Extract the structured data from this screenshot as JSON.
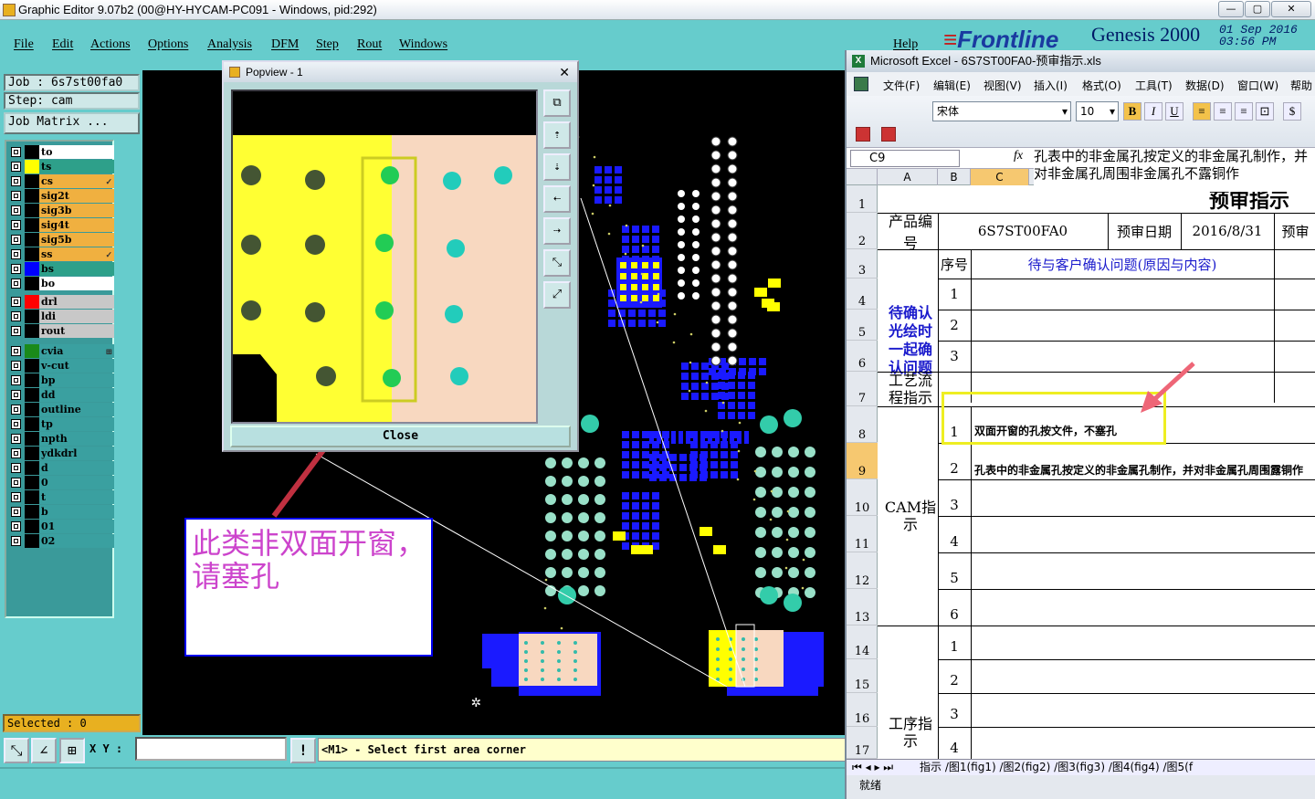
{
  "genesis": {
    "title": "Graphic Editor 9.07b2 (00@HY-HYCAM-PC091 - Windows, pid:292)",
    "menu": [
      "File",
      "Edit",
      "Actions",
      "Options",
      "Analysis",
      "DFM",
      "Step",
      "Rout",
      "Windows"
    ],
    "help": "Help",
    "brand_name": "Frontline",
    "brand_product": "Genesis 2000",
    "date": "01 Sep 2016",
    "time": "03:56 PM",
    "job": "Job : 6s7st00fa0",
    "step": "Step: cam",
    "job_matrix": "Job Matrix ...",
    "layers": [
      {
        "name": "to",
        "color": "#000000",
        "bg": "#ffffff"
      },
      {
        "name": "ts",
        "color": "#ffff00",
        "bg": "#2ea08a"
      },
      {
        "name": "cs",
        "color": "#000000",
        "bg": "#f0b040",
        "mark": "✓"
      },
      {
        "name": "sig2t",
        "color": "#000000",
        "bg": "#f0b040"
      },
      {
        "name": "sig3b",
        "color": "#000000",
        "bg": "#f0b040"
      },
      {
        "name": "sig4t",
        "color": "#000000",
        "bg": "#f0b040"
      },
      {
        "name": "sig5b",
        "color": "#000000",
        "bg": "#f0b040"
      },
      {
        "name": "ss",
        "color": "#000000",
        "bg": "#f0b040",
        "mark": "✓"
      },
      {
        "name": "bs",
        "color": "#0000ff",
        "bg": "#2ea08a"
      },
      {
        "name": "bo",
        "color": "#000000",
        "bg": "#ffffff"
      },
      {
        "name": "drl",
        "color": "#ff0000",
        "bg": "#c8c8c8"
      },
      {
        "name": "ldi",
        "color": "#000000",
        "bg": "#c8c8c8"
      },
      {
        "name": "rout",
        "color": "#000000",
        "bg": "#c8c8c8"
      },
      {
        "name": "cvia",
        "color": "#1a8a1a",
        "bg": "#3aa0a0",
        "mark": "⊞"
      },
      {
        "name": "v-cut",
        "color": "#000000",
        "bg": "#3aa0a0"
      },
      {
        "name": "bp",
        "color": "#000000",
        "bg": "#3aa0a0"
      },
      {
        "name": "dd",
        "color": "#000000",
        "bg": "#3aa0a0"
      },
      {
        "name": "outline",
        "color": "#000000",
        "bg": "#3aa0a0"
      },
      {
        "name": "tp",
        "color": "#000000",
        "bg": "#3aa0a0"
      },
      {
        "name": "npth",
        "color": "#000000",
        "bg": "#3aa0a0"
      },
      {
        "name": "ydkdrl",
        "color": "#000000",
        "bg": "#3aa0a0"
      },
      {
        "name": "d",
        "color": "#000000",
        "bg": "#3aa0a0"
      },
      {
        "name": "0",
        "color": "#000000",
        "bg": "#3aa0a0"
      },
      {
        "name": "t",
        "color": "#000000",
        "bg": "#3aa0a0"
      },
      {
        "name": "b",
        "color": "#000000",
        "bg": "#3aa0a0"
      },
      {
        "name": "01",
        "color": "#000000",
        "bg": "#3aa0a0"
      },
      {
        "name": "02",
        "color": "#000000",
        "bg": "#3aa0a0"
      }
    ],
    "selected": "Selected : 0",
    "xy_label": "X Y :",
    "status_message": "<M1> - Select first area corner",
    "popview_title": "Popview - 1",
    "close_label": "Close",
    "annotation": "此类非双面开窗，请塞孔"
  },
  "excel": {
    "title": "Microsoft Excel - 6S7ST00FA0-预审指示.xls",
    "menu": [
      "文件(F)",
      "编辑(E)",
      "视图(V)",
      "插入(I)",
      "格式(O)",
      "工具(T)",
      "数据(D)",
      "窗口(W)",
      "帮助"
    ],
    "font": "宋体",
    "font_size": "10",
    "cell_ref": "C9",
    "formula": "孔表中的非金属孔按定义的非金属孔制作，并对非金属孔周围非金属孔不露铜作",
    "columns": [
      "A",
      "B",
      "C"
    ],
    "rows": [
      "1",
      "2",
      "3",
      "4",
      "5",
      "6",
      "7",
      "8",
      "9",
      "10",
      "11",
      "12",
      "13",
      "14",
      "15",
      "16",
      "17"
    ],
    "sheet_title": "预审指示",
    "product_label": "产品编号",
    "product_code": "6S7ST00FA0",
    "review_date_label": "预审日期",
    "review_date": "2016/8/31",
    "review_cut": "预审",
    "seq_label": "序号",
    "pending_header": "待与客户确认问题(原因与内容)",
    "pending_group": "待确认光绘时一起确认问题",
    "process_label": "工艺流程指示",
    "cam_label": "CAM指示",
    "work_label": "工序指示",
    "seq": [
      "1",
      "2",
      "3",
      "1",
      "2",
      "3",
      "4",
      "5",
      "6",
      "1",
      "2",
      "3",
      "4"
    ],
    "cam_item1": "双面开窗的孔按文件，不塞孔",
    "cam_item2": "孔表中的非金属孔按定义的非金属孔制作，并对非金属孔周围露铜作",
    "sheet_tabs": "指示 /图1(fig1) /图2(fig2) /图3(fig3) /图4(fig4) /图5(f",
    "status": "就绪"
  }
}
